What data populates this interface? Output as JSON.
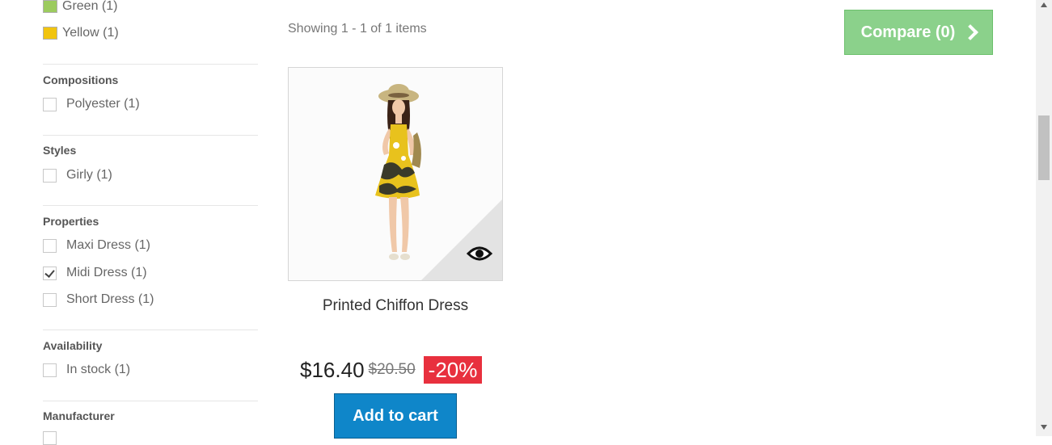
{
  "filters": {
    "colors": [
      {
        "label": "Green (1)",
        "swatch": "#9ccb5e"
      },
      {
        "label": "Yellow (1)",
        "swatch": "#f1c40f"
      }
    ],
    "groups": [
      {
        "title": "Compositions",
        "options": [
          {
            "label": "Polyester (1)",
            "checked": false
          }
        ]
      },
      {
        "title": "Styles",
        "options": [
          {
            "label": "Girly (1)",
            "checked": false
          }
        ]
      },
      {
        "title": "Properties",
        "options": [
          {
            "label": "Maxi Dress (1)",
            "checked": false
          },
          {
            "label": "Midi Dress (1)",
            "checked": true
          },
          {
            "label": "Short Dress (1)",
            "checked": false
          }
        ]
      },
      {
        "title": "Availability",
        "options": [
          {
            "label": "In stock (1)",
            "checked": false
          }
        ]
      },
      {
        "title": "Manufacturer",
        "options": []
      }
    ]
  },
  "listing": {
    "showing": "Showing 1 - 1 of 1 items",
    "compare_label": "Compare (0)"
  },
  "product": {
    "name": "Printed Chiffon Dress",
    "price": "$16.40",
    "old_price": "$20.50",
    "discount": "-20%",
    "add_to_cart": "Add to cart",
    "quick_view_icon": "eye-icon"
  },
  "colors": {
    "compare_bg": "#8bd18b",
    "cart_bg": "#0f86c9",
    "discount_bg": "#e8303e"
  }
}
